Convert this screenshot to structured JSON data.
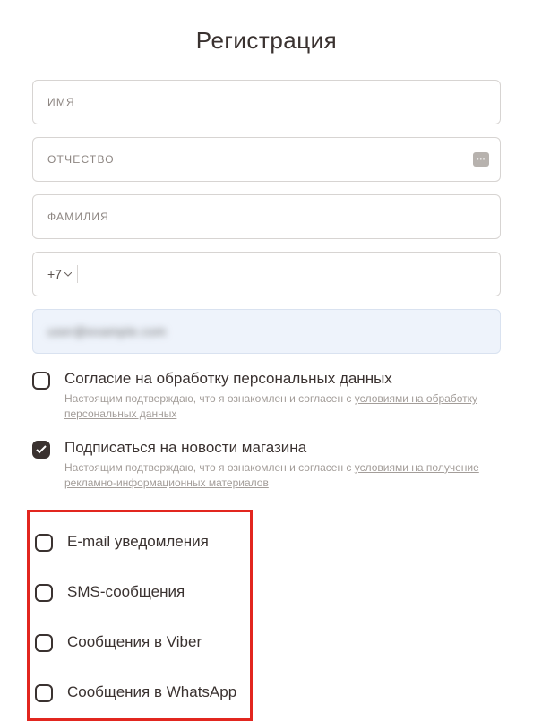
{
  "title": "Регистрация",
  "fields": {
    "first_name": {
      "placeholder": "ИМЯ"
    },
    "patronymic": {
      "placeholder": "ОТЧЕСТВО"
    },
    "last_name": {
      "placeholder": "ФАМИЛИЯ"
    },
    "phone": {
      "prefix": "+7"
    },
    "email": {
      "value": "user@example.com"
    }
  },
  "consents": {
    "personal_data": {
      "title": "Согласие на обработку персональных данных",
      "sub_prefix": "Настоящим подтверждаю, что я ознакомлен и согласен с ",
      "link_text": "условиями на обработку персональных данных",
      "checked": false
    },
    "newsletter": {
      "title": "Подписаться на новости магазина",
      "sub_prefix": "Настоящим подтверждаю, что я ознакомлен и согласен с ",
      "link_text": "условиями на получение рекламно-информационных материалов",
      "checked": true
    }
  },
  "channels": [
    {
      "label": "E-mail уведомления",
      "checked": false
    },
    {
      "label": "SMS-сообщения",
      "checked": false
    },
    {
      "label": "Сообщения в Viber",
      "checked": false
    },
    {
      "label": "Сообщения в WhatsApp",
      "checked": false
    }
  ]
}
